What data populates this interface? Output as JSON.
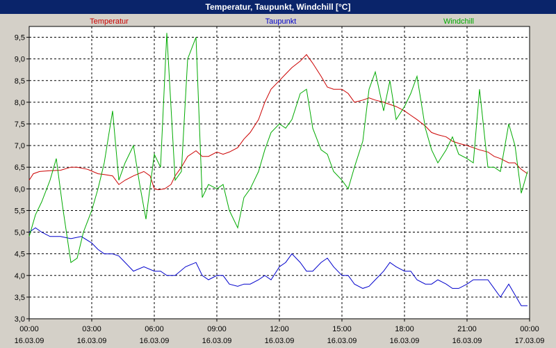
{
  "window": {
    "title": "Temperatur, Taupunkt, Windchill [°C]"
  },
  "chart_data": {
    "type": "line",
    "title": "Temperatur, Taupunkt, Windchill [°C]",
    "xlabel": "",
    "ylabel": "",
    "ylim": [
      3.0,
      9.75
    ],
    "xlim": [
      "16.03.09 00:00",
      "17.03.09 00:00"
    ],
    "grid": true,
    "legend_placement": "top",
    "y_ticks": [
      "3,0",
      "3,5",
      "4,0",
      "4,5",
      "5,0",
      "5,5",
      "6,0",
      "6,5",
      "7,0",
      "7,5",
      "8,0",
      "8,5",
      "9,0",
      "9,5"
    ],
    "x_ticks": [
      {
        "time": "00:00",
        "date": "16.03.09"
      },
      {
        "time": "03:00",
        "date": "16.03.09"
      },
      {
        "time": "06:00",
        "date": "16.03.09"
      },
      {
        "time": "09:00",
        "date": "16.03.09"
      },
      {
        "time": "12:00",
        "date": "16.03.09"
      },
      {
        "time": "15:00",
        "date": "16.03.09"
      },
      {
        "time": "18:00",
        "date": "16.03.09"
      },
      {
        "time": "21:00",
        "date": "16.03.09"
      },
      {
        "time": "00:00",
        "date": "17.03.09"
      }
    ],
    "series": [
      {
        "name": "Temperatur",
        "color": "#cc0000",
        "x": [
          0,
          0.2,
          0.5,
          1,
          1.5,
          2,
          2.3,
          2.8,
          3.3,
          3.6,
          4,
          4.3,
          4.6,
          5,
          5.5,
          5.8,
          6,
          6.2,
          6.5,
          6.8,
          7,
          7.3,
          7.6,
          8,
          8.3,
          8.6,
          9,
          9.3,
          9.6,
          10,
          10.3,
          10.6,
          11,
          11.3,
          11.6,
          12,
          12.3,
          12.6,
          13,
          13.3,
          13.6,
          14,
          14.3,
          14.6,
          15,
          15.3,
          15.6,
          16,
          16.3,
          16.6,
          17,
          17.3,
          17.6,
          18,
          18.3,
          18.6,
          19,
          19.3,
          19.6,
          20,
          20.3,
          20.6,
          21,
          21.3,
          21.6,
          22,
          22.3,
          22.6,
          23,
          23.3,
          23.6,
          23.9
        ],
        "y": [
          6.2,
          6.35,
          6.4,
          6.42,
          6.43,
          6.5,
          6.5,
          6.45,
          6.35,
          6.33,
          6.3,
          6.1,
          6.2,
          6.3,
          6.4,
          6.3,
          6.0,
          5.98,
          6.0,
          6.1,
          6.3,
          6.5,
          6.75,
          6.88,
          6.75,
          6.75,
          6.85,
          6.8,
          6.85,
          6.95,
          7.15,
          7.3,
          7.6,
          8.0,
          8.3,
          8.5,
          8.65,
          8.8,
          8.95,
          9.1,
          8.9,
          8.6,
          8.35,
          8.3,
          8.3,
          8.2,
          8.0,
          8.05,
          8.1,
          8.05,
          8.0,
          7.95,
          7.9,
          7.8,
          7.7,
          7.6,
          7.45,
          7.3,
          7.25,
          7.2,
          7.1,
          7.05,
          7.0,
          6.95,
          6.9,
          6.85,
          6.75,
          6.7,
          6.6,
          6.6,
          6.45,
          6.35
        ]
      },
      {
        "name": "Taupunkt",
        "color": "#0000cc",
        "x": [
          0,
          0.3,
          0.6,
          1,
          1.5,
          2,
          2.5,
          3,
          3.3,
          3.6,
          4,
          4.3,
          4.6,
          5,
          5.5,
          6,
          6.3,
          6.6,
          7,
          7.5,
          8,
          8.3,
          8.6,
          9,
          9.3,
          9.6,
          10,
          10.3,
          10.6,
          11,
          11.3,
          11.6,
          12,
          12.3,
          12.6,
          13,
          13.3,
          13.6,
          14,
          14.3,
          14.6,
          15,
          15.3,
          15.6,
          16,
          16.3,
          16.6,
          17,
          17.3,
          17.6,
          18,
          18.3,
          18.6,
          19,
          19.3,
          19.6,
          20,
          20.3,
          20.6,
          21,
          21.3,
          21.6,
          22,
          22.3,
          22.6,
          23,
          23.3,
          23.6,
          23.9
        ],
        "y": [
          5.0,
          5.1,
          5.0,
          4.9,
          4.9,
          4.85,
          4.9,
          4.75,
          4.6,
          4.5,
          4.5,
          4.45,
          4.3,
          4.1,
          4.2,
          4.1,
          4.1,
          4.0,
          4.0,
          4.2,
          4.3,
          4.0,
          3.9,
          4.0,
          4.0,
          3.8,
          3.75,
          3.8,
          3.8,
          3.9,
          4.0,
          3.9,
          4.2,
          4.3,
          4.5,
          4.3,
          4.1,
          4.1,
          4.3,
          4.4,
          4.2,
          4.0,
          4.0,
          3.8,
          3.7,
          3.75,
          3.9,
          4.1,
          4.3,
          4.2,
          4.1,
          4.1,
          3.9,
          3.8,
          3.8,
          3.9,
          3.8,
          3.7,
          3.7,
          3.8,
          3.9,
          3.9,
          3.9,
          3.7,
          3.5,
          3.8,
          3.55,
          3.3,
          3.3
        ]
      },
      {
        "name": "Windchill",
        "color": "#00aa00",
        "x": [
          0,
          0.3,
          0.6,
          1,
          1.3,
          1.6,
          2,
          2.3,
          2.6,
          3,
          3.3,
          3.6,
          4,
          4.3,
          4.6,
          5,
          5.3,
          5.6,
          6,
          6.3,
          6.6,
          7,
          7.3,
          7.6,
          8,
          8.3,
          8.6,
          9,
          9.3,
          9.6,
          10,
          10.3,
          10.6,
          11,
          11.3,
          11.6,
          12,
          12.3,
          12.6,
          13,
          13.3,
          13.6,
          14,
          14.3,
          14.6,
          15,
          15.3,
          15.6,
          16,
          16.3,
          16.6,
          17,
          17.3,
          17.6,
          18,
          18.3,
          18.6,
          19,
          19.3,
          19.6,
          20,
          20.3,
          20.6,
          21,
          21.3,
          21.6,
          22,
          22.3,
          22.6,
          23,
          23.3,
          23.6,
          23.9
        ],
        "y": [
          4.9,
          5.4,
          5.7,
          6.2,
          6.7,
          5.6,
          4.3,
          4.4,
          5.0,
          5.5,
          6.0,
          6.6,
          7.8,
          6.2,
          6.6,
          7.0,
          6.1,
          5.3,
          6.8,
          6.5,
          9.6,
          6.2,
          6.4,
          9.0,
          9.5,
          5.8,
          6.1,
          6.0,
          6.1,
          5.5,
          5.1,
          5.8,
          6.0,
          6.4,
          6.9,
          7.3,
          7.5,
          7.4,
          7.6,
          8.2,
          8.3,
          7.4,
          6.9,
          6.8,
          6.4,
          6.2,
          6.0,
          6.5,
          7.1,
          8.3,
          8.7,
          7.8,
          8.5,
          7.6,
          7.9,
          8.2,
          8.6,
          7.4,
          6.9,
          6.6,
          6.9,
          7.2,
          6.8,
          6.7,
          6.6,
          8.3,
          6.5,
          6.5,
          6.4,
          7.5,
          7.0,
          5.9,
          6.4
        ]
      }
    ]
  }
}
